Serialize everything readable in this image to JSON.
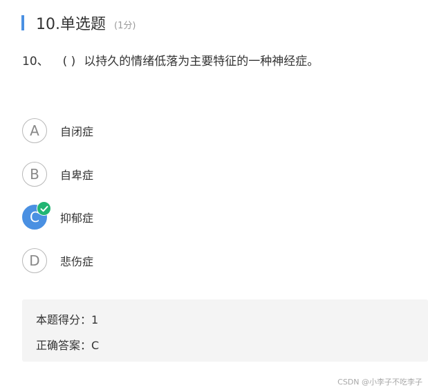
{
  "question": {
    "title": "10.单选题",
    "score": "(1分)",
    "number": "10、",
    "paren": "( )",
    "stem": "以持久的情绪低落为主要特征的一种神经症。"
  },
  "options": [
    {
      "letter": "A",
      "text": "自闭症",
      "selected": false
    },
    {
      "letter": "B",
      "text": "自卑症",
      "selected": false
    },
    {
      "letter": "C",
      "text": "抑郁症",
      "selected": true
    },
    {
      "letter": "D",
      "text": "悲伤症",
      "selected": false
    }
  ],
  "result": {
    "score_line": "本题得分：1",
    "answer_line": "正确答案：C"
  },
  "watermark": "CSDN @小李子不吃李子",
  "colors": {
    "accent": "#4a90e2",
    "correct": "#22b573"
  },
  "icons": {
    "selected_marker": "check-icon"
  }
}
